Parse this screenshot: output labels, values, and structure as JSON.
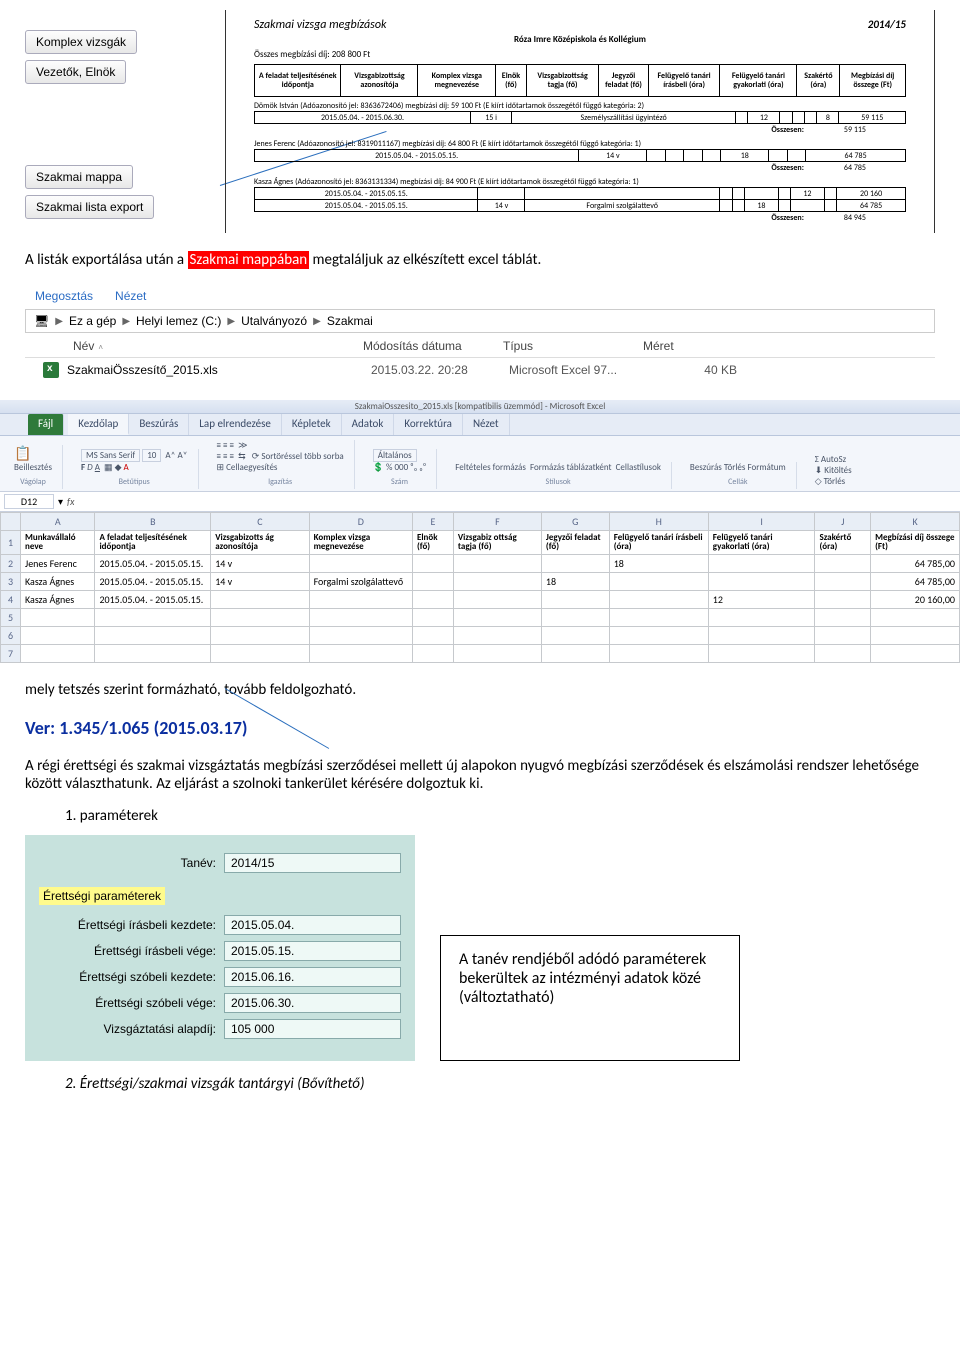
{
  "buttons": {
    "komplex": "Komplex vizsgák",
    "vezetok": "Vezetők, Elnök",
    "mappa": "Szakmai mappa",
    "export": "Szakmai lista export"
  },
  "report": {
    "title": "Szakmai vizsga megbízások",
    "year": "2014/15",
    "school": "Róza Imre Középiskola és Kollégium",
    "total_line": "Összes megbízási díj: 208 800 Ft",
    "head": [
      "A feladat teljesítésének időpontja",
      "Vizsgabizottság azonosítója",
      "Komplex vizsga megnevezése",
      "Elnök (fő)",
      "Vizsgabizottság tagja (fő)",
      "Jegyzői feladat (fő)",
      "Felügyelő tanári írásbeli (óra)",
      "Felügyelő tanári gyakorlati (óra)",
      "Szakértő (óra)",
      "Megbízási díj összege (Ft)"
    ],
    "people": [
      {
        "line": "Dömök István (Adóazonosító jel: 8363672406) megbízási díj: 59 100 Ft (E kiírt időtartamok összegétől függő kategória: 2)",
        "rows": [
          [
            "2015.05.04. - 2015.06.30.",
            "15 i",
            "Személyszállítási ügyintéző",
            "",
            "12",
            "",
            "",
            "",
            "8",
            "59 115"
          ]
        ],
        "sum_label": "Összesen:",
        "sum_value": "59 115"
      },
      {
        "line": "Jenes Ferenc (Adóazonosító jel: 8319011167) megbízási díj: 64 800 Ft (E kiírt időtartamok összegétől függő kategória: 1)",
        "rows": [
          [
            "2015.05.04. - 2015.05.15.",
            "14 v",
            "",
            "",
            "",
            "",
            "18",
            "",
            "",
            "64 785"
          ]
        ],
        "sum_label": "Összesen:",
        "sum_value": "64 785"
      },
      {
        "line": "Kasza Ágnes (Adóazonosító jel: 8363131334) megbízási díj: 84 900 Ft (E kiírt időtartamok összegétől függő kategória: 1)",
        "rows": [
          [
            "2015.05.04. - 2015.05.15.",
            "",
            "",
            "",
            "",
            "",
            "",
            "12",
            "",
            "20 160"
          ],
          [
            "2015.05.04. - 2015.05.15.",
            "14 v",
            "Forgalmi szolgálattevő",
            "",
            "",
            "18",
            "",
            "",
            "",
            "64 785"
          ]
        ],
        "sum_label": "Összesen:",
        "sum_value": "84 945"
      }
    ]
  },
  "para1_a": "A listák exportálása után a ",
  "para1_hl": "Szakmai mappában",
  "para1_b": " megtaláljuk az elkészített excel táblát.",
  "explorer": {
    "share": "Megosztás",
    "view": "Nézet",
    "bc_pc": "Ez a gép",
    "bc_disk": "Helyi lemez (C:)",
    "bc_app": "Utalványozó",
    "bc_folder": "Szakmai",
    "col_name": "Név",
    "col_date": "Módosítás dátuma",
    "col_type": "Típus",
    "col_size": "Méret",
    "file_name": "SzakmaiÖsszesítő_2015.xls",
    "file_date": "2015.03.22. 20:28",
    "file_type": "Microsoft Excel 97...",
    "file_size": "40 KB"
  },
  "excel": {
    "title_suffix": "SzakmaiOsszesito_2015.xls  [kompatibilis üzemmód]  -  Microsoft Excel",
    "tabs": {
      "file": "Fájl",
      "home": "Kezdőlap",
      "insert": "Beszúrás",
      "layout": "Lap elrendezése",
      "formulas": "Képletek",
      "data": "Adatok",
      "review": "Korrektúra",
      "view": "Nézet"
    },
    "font_name": "MS Sans Serif",
    "font_size": "10",
    "grp_clipboard": "Vágólap",
    "grp_font": "Betűtípus",
    "grp_align": "Igazítás",
    "grp_number": "Szám",
    "grp_styles": "Stílusok",
    "grp_cells": "Cellák",
    "btn_paste": "Beillesztés",
    "btn_sort": "Sortöréssel több sorba",
    "btn_merge": "Cellaegyesítés",
    "fmt_general": "Általános",
    "btn_cond": "Feltételes formázás",
    "btn_table": "Formázás táblázatként",
    "btn_styles": "Cellastílusok",
    "btn_insert": "Beszúrás",
    "btn_delete": "Törlés",
    "btn_format": "Formátum",
    "btn_autosum": "AutoSz",
    "btn_fill": "Kitöltés",
    "btn_clear": "Törlés",
    "cell_ref": "D12",
    "cols": [
      "",
      "A",
      "B",
      "C",
      "D",
      "E",
      "F",
      "G",
      "H",
      "I",
      "J",
      "K"
    ],
    "hdr": [
      "Munkavállaló neve",
      "A feladat teljesítésének időpontja",
      "Vizsgabizotts ág azonosítója",
      "Komplex vizsga megnevezése",
      "Elnök (fő)",
      "Vizsgabiz ottság tagja (fő)",
      "Jegyzői feladat (fő)",
      "Felügyelő tanári írásbeli (óra)",
      "Felügyelő tanári gyakorlati (óra)",
      "Szakértő (óra)",
      "Megbízási díj összege (Ft)"
    ],
    "rows": [
      [
        "Jenes Ferenc",
        "2015.05.04. - 2015.05.15.",
        "14 v",
        "",
        "",
        "",
        "",
        "18",
        "",
        "",
        "64 785,00"
      ],
      [
        "Kasza Ágnes",
        "2015.05.04. - 2015.05.15.",
        "14 v",
        "Forgalmi szolgálattevő",
        "",
        "",
        "18",
        "",
        "",
        "",
        "64 785,00"
      ],
      [
        "Kasza Ágnes",
        "2015.05.04. - 2015.05.15.",
        "",
        "",
        "",
        "",
        "",
        "",
        "12",
        "",
        "20 160,00"
      ]
    ]
  },
  "para2": "mely tetszés szerint formázható, tovább feldolgozható.",
  "ver": "Ver: 1.345/1.065  (2015.03.17)",
  "para3": "A régi érettségi és szakmai vizsgáztatás megbízási szerződései mellett új alapokon nyugvó megbízási szerződések és elszámolási rendszer lehetősége között választhatunk. Az eljárást a szolnoki tankerület kérésére dolgoztuk ki.",
  "n1": "1.   paraméterek",
  "form": {
    "tanev_label": "Tanév:",
    "tanev_value": "2014/15",
    "section": "Érettségi paraméterek",
    "ir_kezdete_label": "Érettségi írásbeli kezdete:",
    "ir_kezdete_value": "2015.05.04.",
    "ir_vege_label": "Érettségi írásbeli vége:",
    "ir_vege_value": "2015.05.15.",
    "sz_kezdete_label": "Érettségi szóbeli kezdete:",
    "sz_kezdete_value": "2015.06.16.",
    "sz_vege_label": "Érettségi szóbeli vége:",
    "sz_vege_value": "2015.06.30.",
    "alapdij_label": "Vizsgáztatási alapdíj:",
    "alapdij_value": "105 000"
  },
  "callout": "A tanév rendjéből adódó paraméterek bekerültek az intézményi adatok közé (változtatható)",
  "n2": "2.   Érettségi/szakmai vizsgák tantárgyi (Bővíthető)"
}
